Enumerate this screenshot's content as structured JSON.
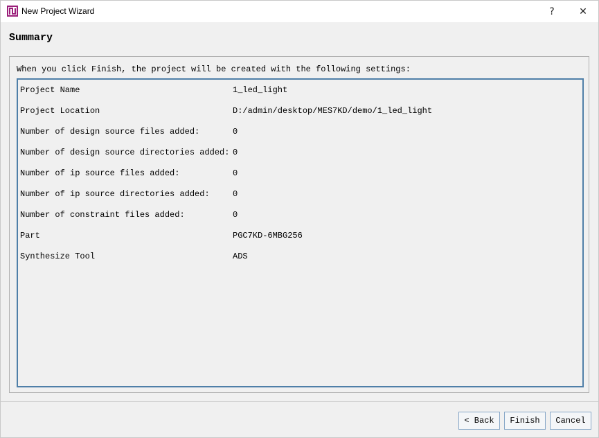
{
  "window": {
    "title": "New Project Wizard",
    "help_label": "?",
    "close_label": "✕",
    "icon": "app-logo-icon"
  },
  "header": {
    "title": "Summary"
  },
  "main": {
    "intro": "When you click Finish, the project will be created with the following settings:",
    "rows": [
      {
        "label": "Project Name",
        "value": "1_led_light"
      },
      {
        "label": "Project Location",
        "value": "D:/admin/desktop/MES7KD/demo/1_led_light"
      },
      {
        "label": "Number of design source files added:",
        "value": "0"
      },
      {
        "label": "Number of design source directories added:",
        "value": "0"
      },
      {
        "label": "Number of ip source files added:",
        "value": "0"
      },
      {
        "label": "Number of ip source directories added:",
        "value": "0"
      },
      {
        "label": "Number of constraint files added:",
        "value": "0"
      },
      {
        "label": "Part",
        "value": "PGC7KD-6MBG256"
      },
      {
        "label": "Synthesize Tool",
        "value": "ADS"
      }
    ]
  },
  "footer": {
    "back_label": "< Back",
    "finish_label": "Finish",
    "cancel_label": "Cancel"
  },
  "colors": {
    "accent_border": "#4f7fa8",
    "icon_magenta": "#9b1f7a",
    "background": "#f0f0f0"
  }
}
